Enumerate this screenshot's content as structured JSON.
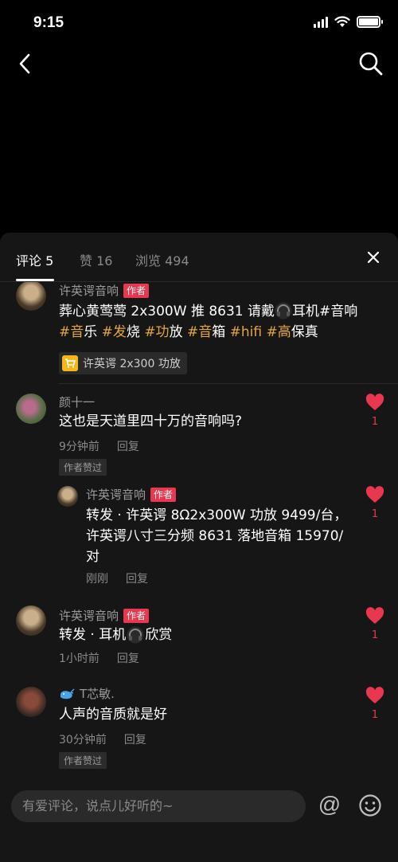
{
  "status": {
    "time": "9:15"
  },
  "tabs": [
    {
      "label": "评论 5",
      "active": true
    },
    {
      "label": "赞 16",
      "active": false
    },
    {
      "label": "浏览 494",
      "active": false
    }
  ],
  "comments": [
    {
      "author": "许英谔音响",
      "badge": "作者",
      "text_segments": [
        {
          "t": "葬心黄莺莺 2x300W 推 8631 请戴"
        },
        {
          "icon": "headphones-emoji"
        },
        {
          "t": "耳机#音响 "
        },
        {
          "t": "#音",
          "tag": true
        },
        {
          "t": "乐 "
        },
        {
          "t": "#发",
          "tag": true
        },
        {
          "t": "烧 "
        },
        {
          "t": "#功",
          "tag": true
        },
        {
          "t": "放 "
        },
        {
          "t": "#音",
          "tag": true
        },
        {
          "t": "箱 "
        },
        {
          "t": "#hifi",
          "tag": true
        },
        {
          "t": " "
        },
        {
          "t": "#高",
          "tag": true
        },
        {
          "t": "保真"
        }
      ],
      "product": "许英谔 2x300 功放"
    },
    {
      "author": "颜十一",
      "text": "这也是天道里四十万的音响吗?",
      "time": "9分钟前",
      "reply": "回复",
      "liked_chip": "作者赞过",
      "likes": "1"
    },
    {
      "author": "许英谔音响",
      "badge": "作者",
      "text": "转发 · 许英谔 8Ω2x300W 功放 9499/台，许英谔八寸三分频 8631 落地音箱 15970/对",
      "time": "刚刚",
      "reply": "回复",
      "likes": "1"
    },
    {
      "author": "许英谔音响",
      "badge": "作者",
      "text_pre": "转发 · 耳机",
      "text_post": "欣赏",
      "time": "1小时前",
      "reply": "回复",
      "likes": "1"
    },
    {
      "author": "T芯敏.",
      "author_icon": "whale-icon",
      "text": "人声的音质就是好",
      "time": "30分钟前",
      "reply": "回复",
      "liked_chip": "作者赞过",
      "likes": "1"
    }
  ],
  "input": {
    "placeholder": "有爱评论，说点儿好听的~"
  },
  "icons": {
    "back": "back-arrow-icon",
    "search": "search-icon",
    "close": "close-icon",
    "at": "@",
    "emoji": "emoji-icon"
  },
  "colors": {
    "accent": "#e8374f",
    "hashtag": "#e3a83a",
    "sheet_bg": "#161616"
  }
}
